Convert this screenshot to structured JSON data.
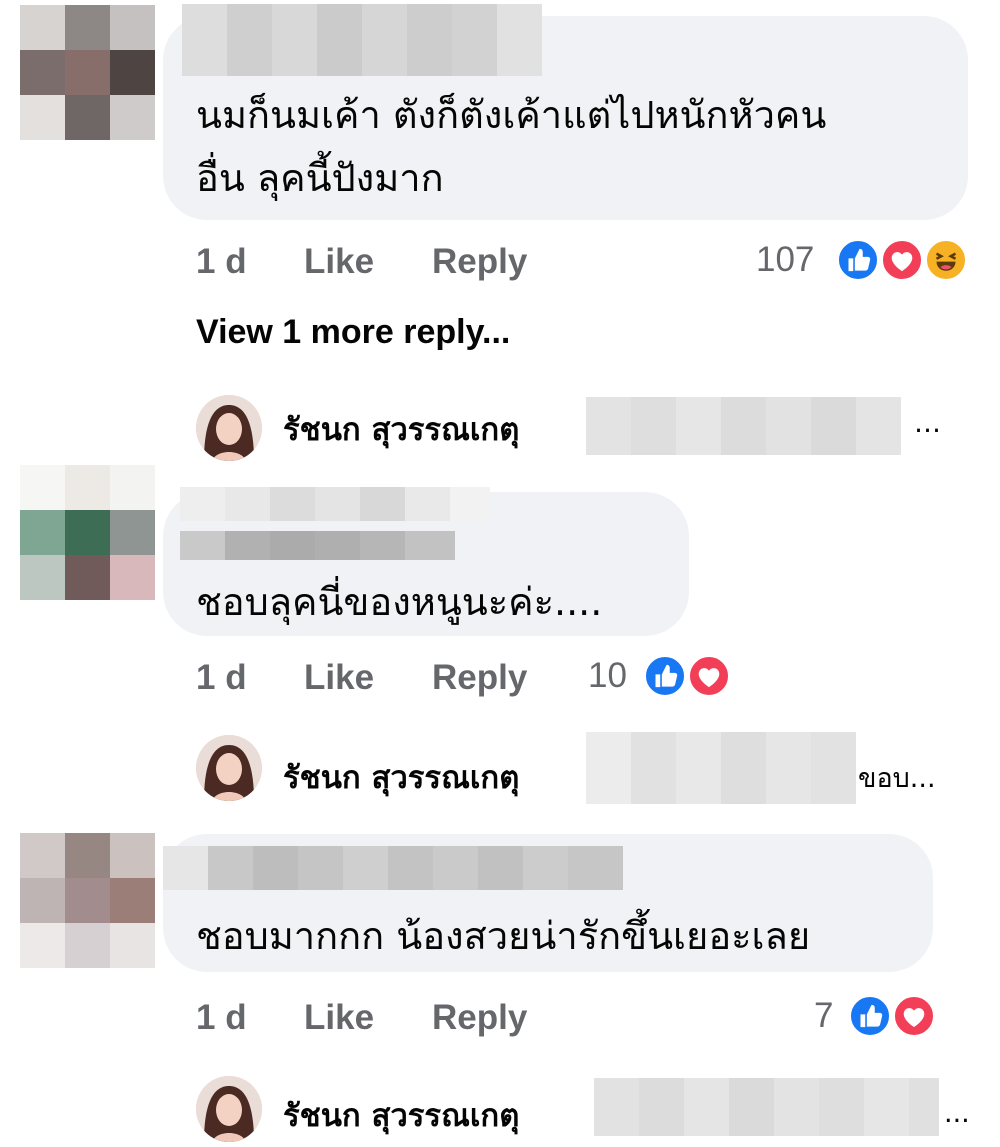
{
  "comments": [
    {
      "text_line1": "นมก็นมเค้า ตังก็ตังเค้าแต่ไปหนักหัวคน",
      "text_line2": "อื่น ลุคนี้ปังมาก",
      "time": "1 d",
      "like_label": "Like",
      "reply_label": "Reply",
      "reaction_count": "107",
      "reactions": [
        "like-icon",
        "love-icon",
        "haha-icon"
      ],
      "more_replies": "View 1 more reply...",
      "reply_preview": {
        "author": "รัชนก สุวรรณเกตุ",
        "tail": "…"
      }
    },
    {
      "text_line1": "ชอบลุคนี่ของหนูนะค่ะ....",
      "time": "1 d",
      "like_label": "Like",
      "reply_label": "Reply",
      "reaction_count": "10",
      "reactions": [
        "like-icon",
        "love-icon"
      ],
      "reply_preview": {
        "author": "รัชนก สุวรรณเกตุ",
        "tail": "ขอบ..."
      }
    },
    {
      "text_line1": "ชอบมากกก น้องสวยน่ารักขึ้นเยอะเลย",
      "time": "1 d",
      "like_label": "Like",
      "reply_label": "Reply",
      "reaction_count": "7",
      "reactions": [
        "like-icon",
        "love-icon"
      ],
      "reply_preview": {
        "author": "รัชนก สุวรรณเกตุ",
        "tail": "..."
      }
    }
  ],
  "colors": {
    "bubble": "#f0f2f5",
    "meta_text": "#65676b",
    "like_blue": "#1877f2",
    "love_red": "#f33e58",
    "haha_yellow": "#f7b125"
  }
}
